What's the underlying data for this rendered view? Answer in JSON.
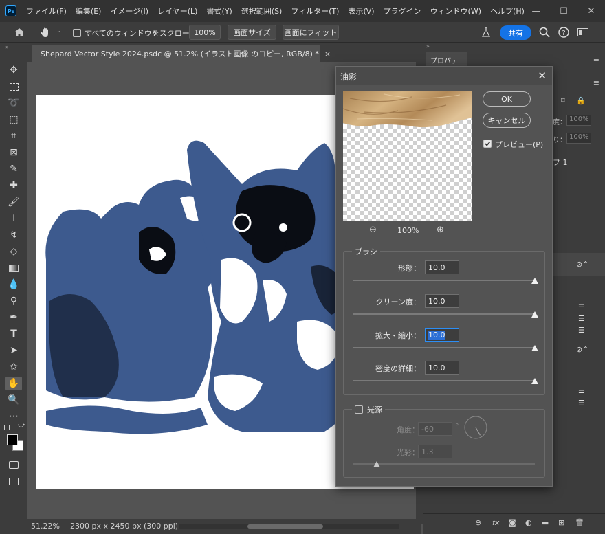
{
  "app": {
    "logo_text": "Ps",
    "menu": [
      "ファイル(F)",
      "編集(E)",
      "イメージ(I)",
      "レイヤー(L)",
      "書式(Y)",
      "選択範囲(S)",
      "フィルター(T)",
      "表示(V)",
      "プラグイン",
      "ウィンドウ(W)",
      "ヘルプ(H)"
    ],
    "window_controls": {
      "minimize": "—",
      "maximize": "☐",
      "close": "✕"
    }
  },
  "options_bar": {
    "scroll_all_label": "すべてのウィンドウをスクロール",
    "zoom_value": "100%",
    "fit_screen_label": "画面サイズ",
    "fill_screen_label": "画面にフィット",
    "share_label": "共有"
  },
  "document": {
    "tab_title": "Shepard Vector Style 2024.psdc @ 51.2% (イラスト画像 のコピー, RGB/8) *",
    "tab_close": "×"
  },
  "status": {
    "zoom": "51.22%",
    "dimensions": "2300 px x 2450 px (300 ppi)",
    "arrow": "›"
  },
  "panel": {
    "tab_label": "プロパティ",
    "field1_label": "度：",
    "field1_value": "100%",
    "field2_label": "り：",
    "field2_value": "100%",
    "layer_label": "プ 1"
  },
  "dialog": {
    "title": "油彩",
    "close": "✕",
    "ok_label": "OK",
    "cancel_label": "キャンセル",
    "preview_checkbox_label": "プレビュー(P)",
    "preview_checked": true,
    "zoom_out": "⊖",
    "zoom_in": "⊕",
    "zoom_value": "100%",
    "brush": {
      "title": "ブラシ",
      "rows": [
        {
          "label": "形態：",
          "value": "10.0",
          "level": 1.0
        },
        {
          "label": "クリーン度：",
          "value": "10.0",
          "level": 1.0
        },
        {
          "label": "拡大・縮小：",
          "value": "10.0",
          "level": 1.0
        },
        {
          "label": "密度の詳細：",
          "value": "10.0",
          "level": 1.0
        }
      ]
    },
    "light": {
      "title": "光源",
      "checked": false,
      "angle_label": "角度：",
      "angle_value": "-60",
      "degree": "°",
      "shine_label": "光彩：",
      "shine_value": "1.3",
      "shine_level": 0.13
    }
  },
  "colors": {
    "accent": "#1473e6",
    "artwork_blue": "#3d5a8e",
    "artwork_dark": "#0a0d14"
  }
}
